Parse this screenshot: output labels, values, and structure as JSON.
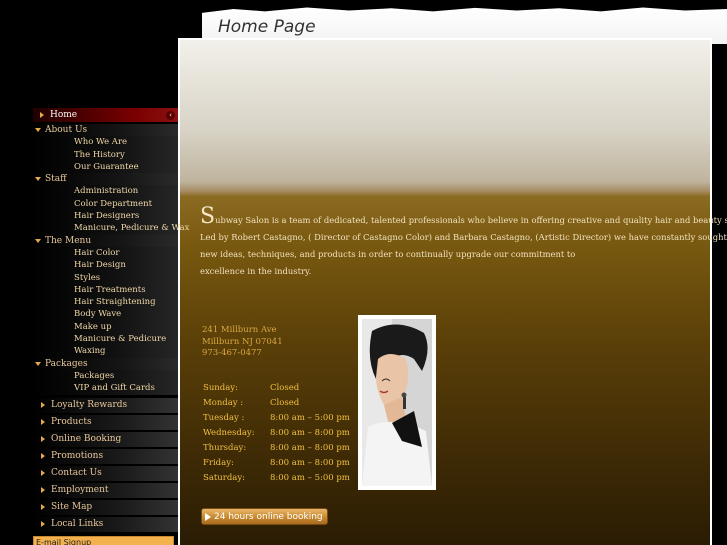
{
  "header": {
    "title": "Home Page"
  },
  "sidebar": {
    "home": "Home",
    "about": {
      "label": "About Us",
      "items": [
        "Who We Are",
        "The History",
        "Our Guarantee"
      ]
    },
    "staff": {
      "label": "Staff",
      "items": [
        "Administration",
        "Color Department",
        "Hair Designers",
        "Manicure, Pedicure & Wax"
      ]
    },
    "menu": {
      "label": "The Menu",
      "items": [
        "Hair Color",
        "Hair Design",
        "Styles",
        "Hair Treatments",
        "Hair Straightening",
        "Body Wave",
        "Make up",
        "Manicure & Pedicure",
        "Waxing"
      ]
    },
    "packages": {
      "label": "Packages",
      "items": [
        "Packages",
        "VIP and Gift Cards"
      ]
    },
    "lower": [
      "Loyalty Rewards",
      "Products",
      "Online Booking",
      "Promotions",
      "Contact Us",
      "Employment",
      "Site Map",
      "Local Links"
    ],
    "email_signup": "E-mail Signup"
  },
  "intro": {
    "drop_cap": "S",
    "line1": "ubway Salon is a team of dedicated, talented professionals who believe in offering creative and quality hair and beauty services.",
    "line2": "Led by Robert Castagno, ( Director of Castagno Color) and Barbara Castagno, (Artistic Director) we have constantly sought out",
    "line3": "new ideas, techniques, and products in order to continually upgrade our commitment to",
    "line4": "excellence in the industry."
  },
  "address": {
    "street": "241 Millburn Ave",
    "city": "Millburn NJ 07041",
    "phone": "973-467-0477"
  },
  "hours": [
    {
      "day": "Sunday:",
      "time": "Closed"
    },
    {
      "day": "Monday :",
      "time": "Closed"
    },
    {
      "day": "Tuesday :",
      "time": "8:00 am – 5:00 pm"
    },
    {
      "day": "Wednesday:",
      "time": "8:00 am – 8:00 pm"
    },
    {
      "day": "Thursday:",
      "time": "8:00 am – 8:00 pm"
    },
    {
      "day": "Friday:",
      "time": "8:00 am – 8:00 pm"
    },
    {
      "day": "Saturday:",
      "time": "8:00 am – 5:00 pm"
    }
  ],
  "booking": {
    "label": "24 hours online booking"
  },
  "colors": {
    "accent_gold": "#f0c040",
    "active_nav": "#7a0000",
    "button": "#c88a30"
  }
}
